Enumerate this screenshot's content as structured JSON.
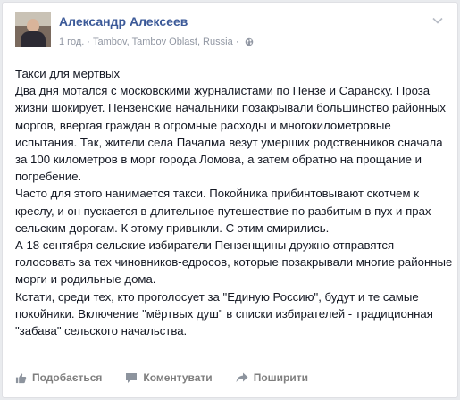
{
  "post": {
    "author": "Александр Алексеев",
    "time": "1 год.",
    "separator": "·",
    "location": "Tambov, Tambov Oblast, Russia",
    "meta_separator": "·",
    "text": "Такси для мертвых\nДва дня мотался с московскими журналистами по Пензе и Саранску. Проза жизни шокирует. Пензенские начальники позакрывали большинство районных моргов, ввергая граждан в огромные расходы и многокилометровые испытания. Так, жители села Пачалма везут умерших родственников сначала за 100 километров в морг города Ломова, а затем обратно на прощание и погребение.\nЧасто для этого нанимается такси. Покойника прибинтовывают скотчем к креслу, и он пускается в длительное путешествие по разбитым в пух и прах сельским дорогам. К этому привыкли. С этим смирились.\nА 18 сентября сельские избиратели Пензенщины дружно отправятся голосовать за тех чиновников-едросов, которые позакрывали многие районные морги и родильные дома.\nКстати, среди тех, кто проголосует за \"Единую Россию\", будут и те самые покойники. Включение \"мёртвых душ\" в списки избирателей - традиционная \"забава\" сельского начальства."
  },
  "actions": {
    "like": "Подобається",
    "comment": "Коментувати",
    "share": "Поширити"
  },
  "icons": {
    "avatar": "avatar-photo",
    "audience": "globe-icon",
    "menu": "chevron-down-icon",
    "like": "thumbs-up-icon",
    "comment": "comment-bubble-icon",
    "share": "share-arrow-icon"
  },
  "colors": {
    "author_link": "#3b5998",
    "meta_text": "#9197a3",
    "action_text": "#7f7f7f",
    "body_text": "#141823"
  }
}
